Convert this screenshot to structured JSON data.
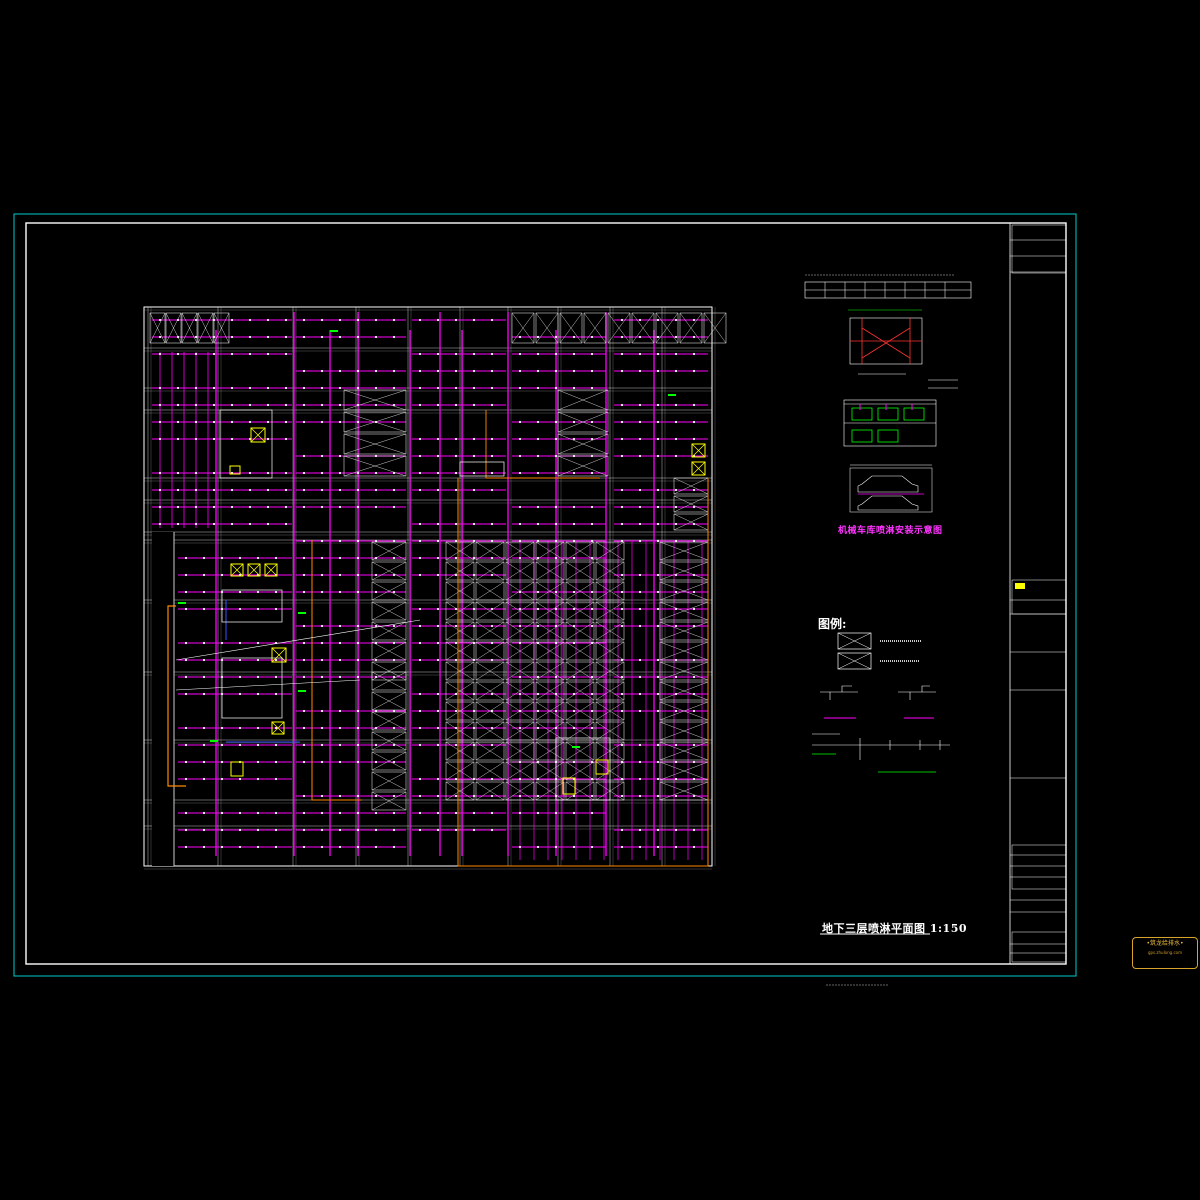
{
  "drawing_title": "地下三层喷淋平面图 1:150",
  "legend_title": "图例:",
  "detail_title": "机械车库喷淋安装示意图",
  "stamp": {
    "line1": "•筑龙给排水•",
    "line2": "gps.zhulong.com"
  },
  "colors": {
    "background": "#000000",
    "frame": "#00cccc",
    "sprinkler_pipe": "#ff00ff",
    "walls": "#ffffff",
    "fire_main": "#ff8800",
    "accent_yellow": "#ffff00",
    "accent_green": "#00ff00"
  }
}
